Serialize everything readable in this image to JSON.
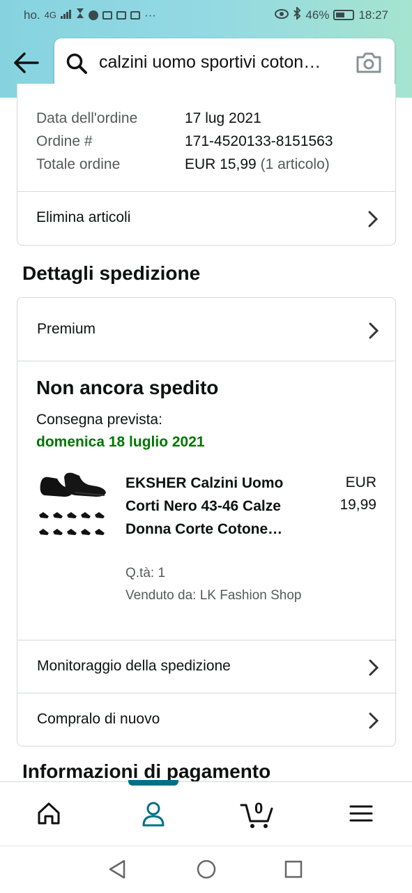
{
  "status_bar": {
    "carrier": "ho.",
    "network": "4G",
    "battery_pct": "46%",
    "time": "18:27",
    "extra": "···"
  },
  "header": {
    "search_query": "calzini uomo sportivi coton…"
  },
  "order_info": {
    "rows": [
      {
        "label": "Data dell'ordine",
        "value": "17 lug 2021"
      },
      {
        "label": "Ordine #",
        "value": "171-4520133-8151563"
      },
      {
        "label": "Totale ordine",
        "value": "EUR 15,99",
        "value_extra": "(1 articolo)"
      }
    ],
    "delete_label": "Elimina articoli"
  },
  "shipping": {
    "section_title": "Dettagli spedizione",
    "premium_label": "Premium",
    "status_title": "Non ancora spedito",
    "delivery_label": "Consegna prevista:",
    "delivery_date": "domenica 18 luglio 2021",
    "product": {
      "name": "EKSHER Calzini Uomo Corti Nero 43-46 Calze Donna Corte Cotone…",
      "price_currency": "EUR",
      "price_value": "19,99",
      "qty": "Q.tà: 1",
      "seller": "Venduto da: LK Fashion Shop"
    },
    "track_label": "Monitoraggio della spedizione",
    "buy_again_label": "Compralo di nuovo"
  },
  "payment": {
    "section_title": "Informazioni di pagamento"
  },
  "bottom_nav": {
    "cart_count": "0",
    "accent": "#007185"
  },
  "colors": {
    "delivery_green": "#007600",
    "header_gradient_start": "#86d3df",
    "header_gradient_end": "#a6e4cf"
  }
}
